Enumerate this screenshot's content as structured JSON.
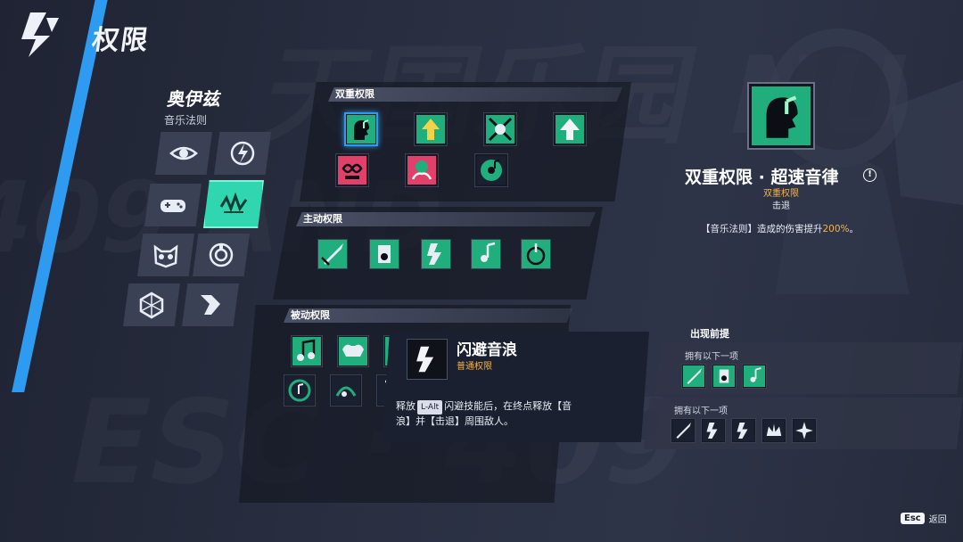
{
  "header": {
    "title": "权限"
  },
  "character": {
    "name": "奥伊兹",
    "subtitle": "音乐法则",
    "tiles": [
      {
        "icon": "eye-icon"
      },
      {
        "icon": "lightning-slash-icon"
      },
      {
        "icon": "gamepad-icon"
      },
      {
        "icon": "music-wave-icon",
        "active": true
      },
      {
        "icon": "owl-mask-icon"
      },
      {
        "icon": "ring-icon"
      },
      {
        "icon": "cube-icon"
      },
      {
        "icon": "rune-icon"
      }
    ]
  },
  "sections": {
    "dual": {
      "label": "双重权限",
      "icons": [
        "music-head-icon",
        "arrow-up-green-icon",
        "lightning-burst-icon",
        "arrow-up-white-icon",
        "infinity-face-icon",
        "octopus-icon",
        "music-disc-icon"
      ]
    },
    "active": {
      "label": "主动权限",
      "icons": [
        "sword-icon",
        "speaker-icon",
        "dash-icon",
        "note-hand-icon",
        "music-spiral-icon"
      ]
    },
    "passive": {
      "label": "被动权限",
      "icons": [
        "music-note-icon",
        "muscle-icon",
        "wave-icon",
        "note-circle-icon",
        "note-swirl-icon",
        "note-rune-icon"
      ]
    }
  },
  "tooltip": {
    "title": "闪避音浪",
    "type": "普通权限",
    "desc_pre": "释放",
    "key": "L-Alt",
    "desc_post": "闪避技能后，在终点释放【音浪】并【击退】周围敌人。"
  },
  "detail": {
    "title": "双重权限 · 超速音律",
    "info": "!",
    "type": "双重权限",
    "tag": "击退",
    "desc_pre": "【音乐法则】造成的伤害提升",
    "desc_value": "200%",
    "desc_post": "。"
  },
  "prereq": {
    "title": "出现前提",
    "groups": [
      {
        "label": "拥有以下一项",
        "icons": [
          "sword-icon",
          "speaker-icon",
          "note-hand-icon"
        ]
      },
      {
        "label": "拥有以下一项",
        "icons": [
          "sword-icon",
          "dash-icon",
          "dash-icon",
          "crown-icon",
          "burst-icon"
        ]
      }
    ]
  },
  "footer": {
    "esc_key": "Esc",
    "esc_label": "返回"
  },
  "colors": {
    "accent_blue": "#2f9bf0",
    "accent_teal": "#2fd6b0",
    "highlight_gold": "#f3b24a",
    "icon_green": "#3fd49a"
  }
}
